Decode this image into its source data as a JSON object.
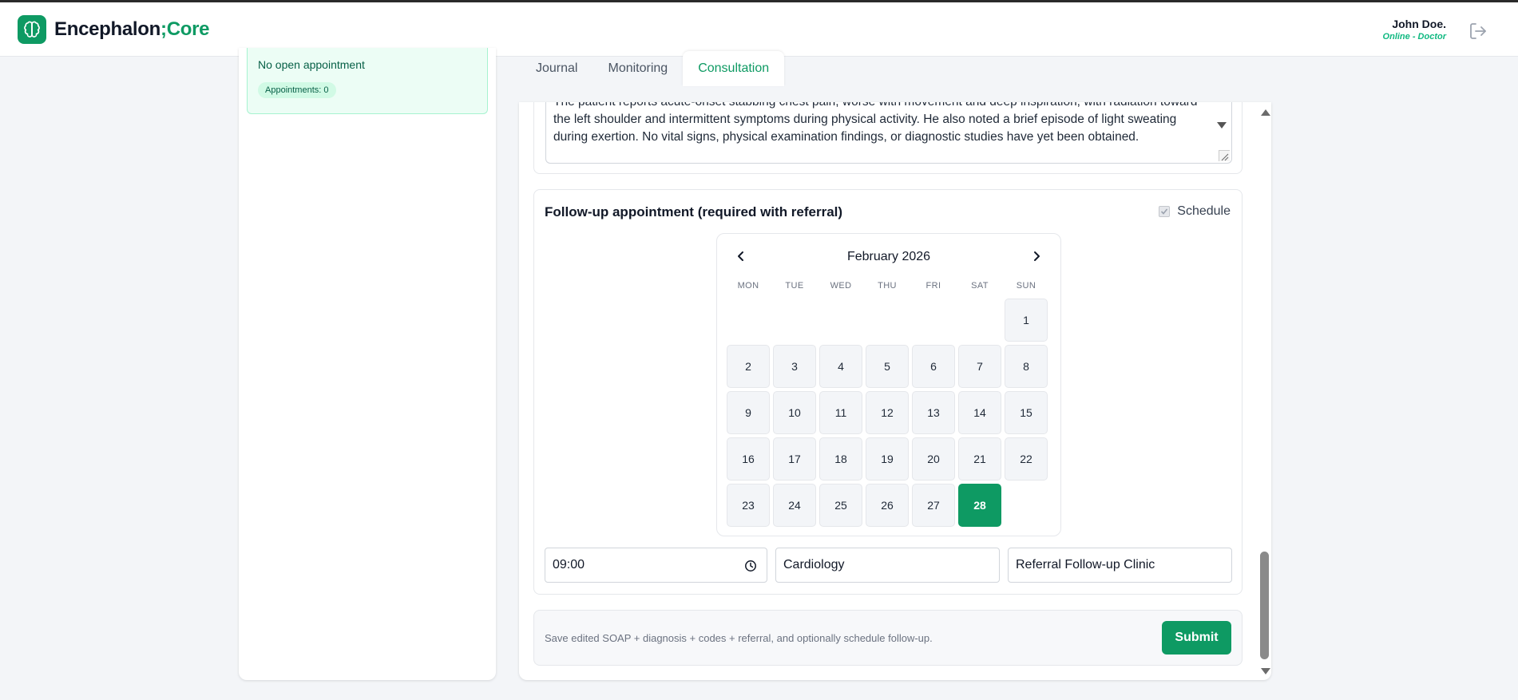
{
  "header": {
    "brand_main": "Encephalon",
    "brand_sep": ";",
    "brand_accent": "Core",
    "user_name": "John Doe.",
    "user_status": "Online - Doctor"
  },
  "sidebar": {
    "appointment_status": "No open appointment",
    "appointments_badge": "Appointments: 0"
  },
  "tabs": [
    {
      "label": "Journal",
      "active": false
    },
    {
      "label": "Monitoring",
      "active": false
    },
    {
      "label": "Consultation",
      "active": true
    }
  ],
  "notes": {
    "text": "The patient reports acute-onset stabbing chest pain, worse with movement and deep inspiration, with radiation toward the left shoulder and intermittent symptoms during physical activity. He also noted a brief episode of light sweating during exertion. No vital signs, physical examination findings, or diagnostic studies have yet been obtained."
  },
  "followup": {
    "title": "Follow-up appointment (required with referral)",
    "schedule_label": "Schedule",
    "schedule_checked": true,
    "calendar": {
      "month_label": "February 2026",
      "weekdays": [
        "MON",
        "TUE",
        "WED",
        "THU",
        "FRI",
        "SAT",
        "SUN"
      ],
      "leading_blanks": 6,
      "days": [
        "1",
        "2",
        "3",
        "4",
        "5",
        "6",
        "7",
        "8",
        "9",
        "10",
        "11",
        "12",
        "13",
        "14",
        "15",
        "16",
        "17",
        "18",
        "19",
        "20",
        "21",
        "22",
        "23",
        "24",
        "25",
        "26",
        "27",
        "28"
      ],
      "selected_day": "28"
    },
    "time_value": "09:00",
    "department_value": "Cardiology",
    "clinic_value": "Referral Follow-up Clinic"
  },
  "submit": {
    "hint": "Save edited SOAP + diagnosis + codes + referral, and optionally schedule follow-up.",
    "button_label": "Submit"
  },
  "colors": {
    "brand": "#0e9a63",
    "status_online": "#10b981"
  }
}
